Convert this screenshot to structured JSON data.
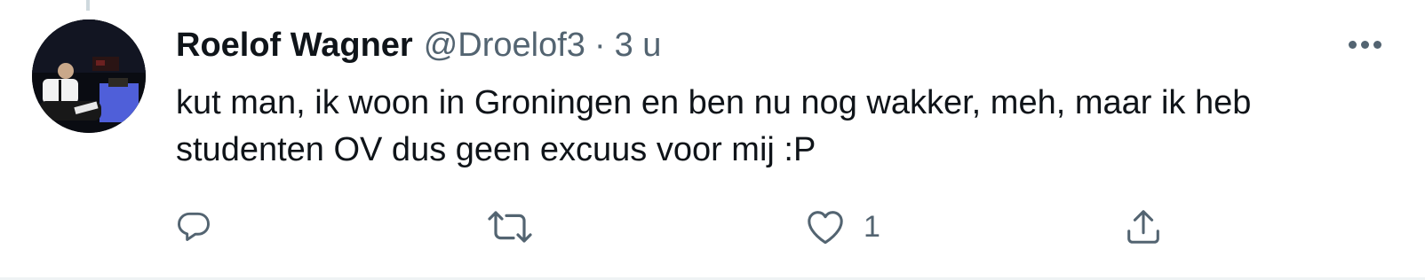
{
  "tweet": {
    "author": {
      "display_name": "Roelof Wagner",
      "handle": "@Droelof3"
    },
    "separator": "·",
    "timestamp": "3 u",
    "text": "kut man, ik woon in Groningen en ben nu nog wakker, meh, maar ik heb\nstudenten OV dus geen excuus voor mij :P",
    "actions": {
      "reply_icon": "reply-icon",
      "retweet_icon": "retweet-icon",
      "like_icon": "heart-icon",
      "like_count": "1",
      "share_icon": "share-icon"
    },
    "more_icon": "more-options-icon"
  },
  "colors": {
    "primary_text": "#0f1419",
    "secondary_text": "#536471",
    "divider": "#eff3f4",
    "thread_line": "#cfd9de"
  }
}
